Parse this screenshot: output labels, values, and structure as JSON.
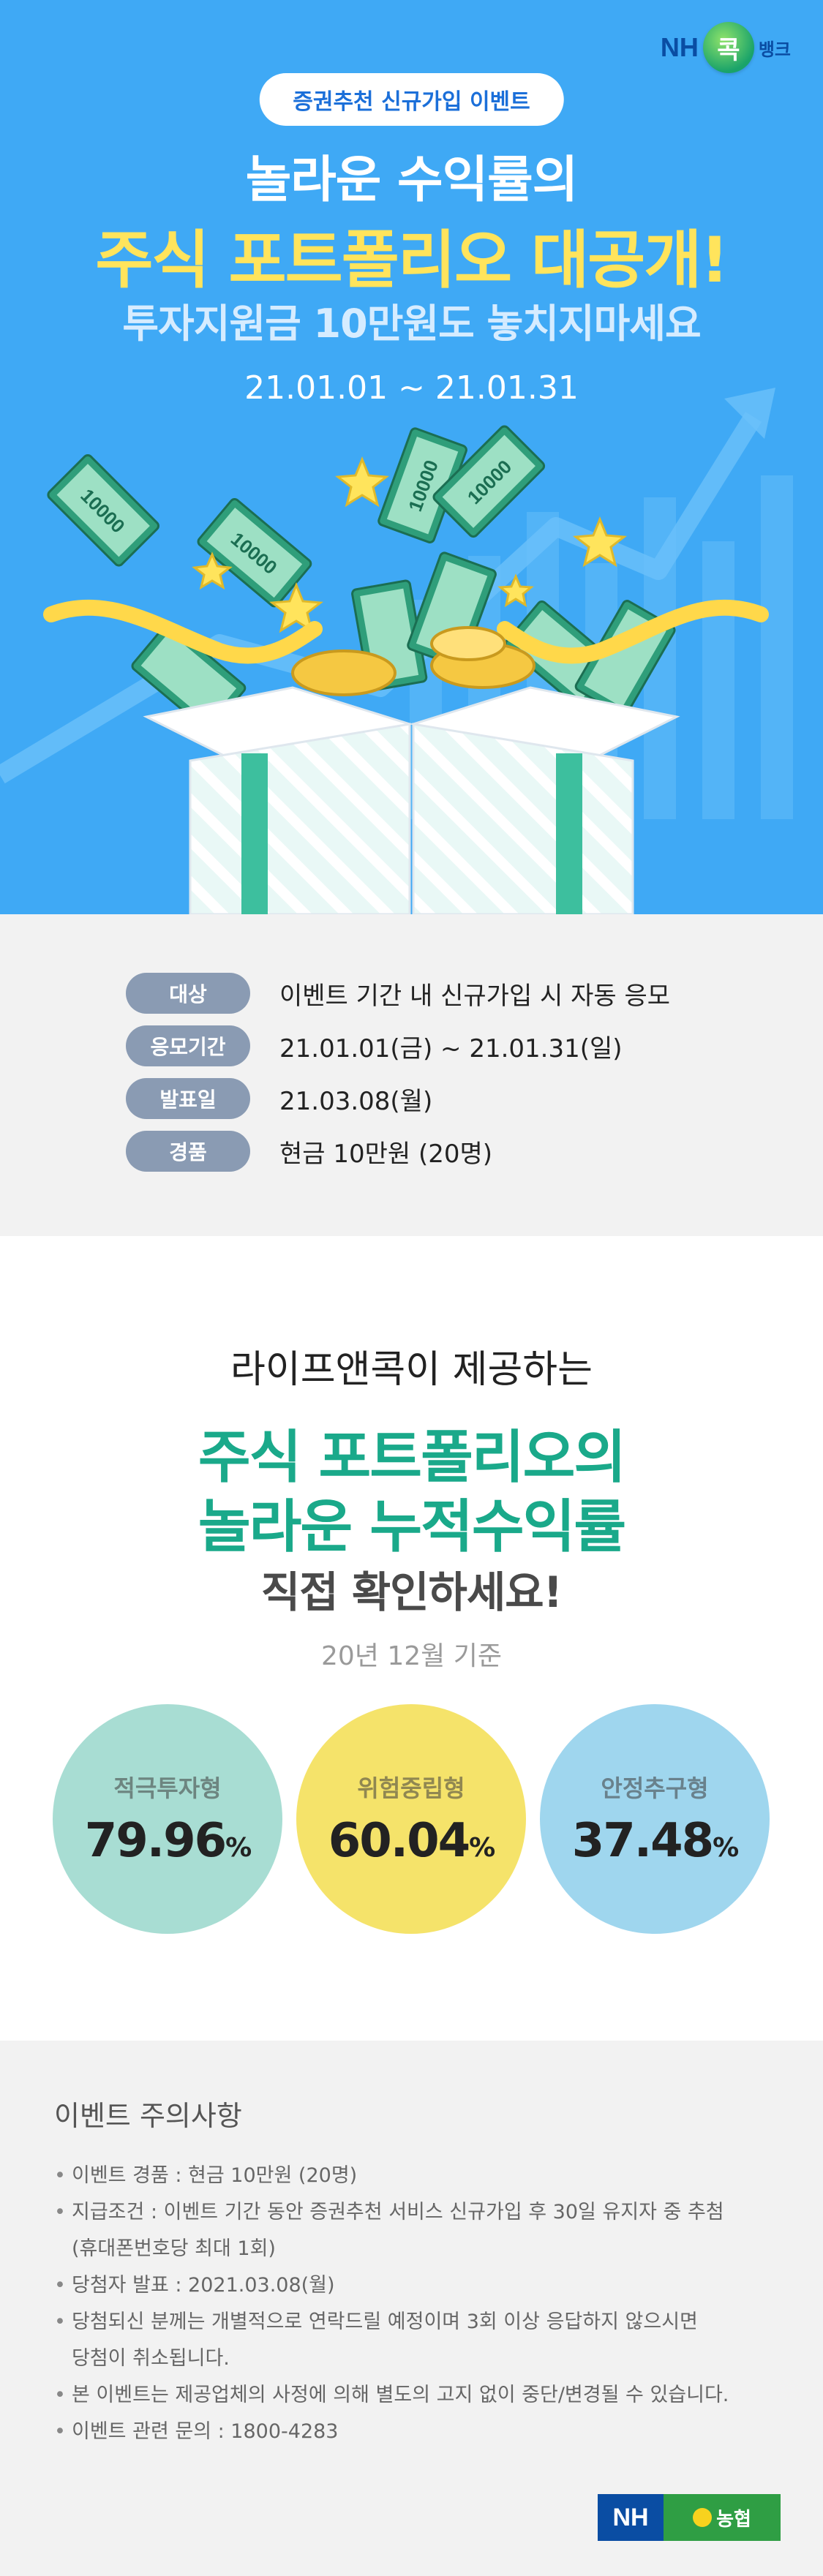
{
  "hero": {
    "logo": {
      "nh": "NH",
      "kok": "콕",
      "bank": "뱅크"
    },
    "pill": "증권추천 신규가입 이벤트",
    "line1": "놀라운 수익률의",
    "line2": "주식 포트폴리오 대공개!",
    "line3": "투자지원금 10만원도 놓치지마세요",
    "date": "21.01.01 ~ 21.01.31",
    "bill_text": "10000"
  },
  "info": {
    "rows": [
      {
        "tag": "대상",
        "value": "이벤트 기간 내 신규가입 시 자동 응모"
      },
      {
        "tag": "응모기간",
        "value": "21.01.01(금) ~ 21.01.31(일)"
      },
      {
        "tag": "발표일",
        "value": "21.03.08(월)"
      },
      {
        "tag": "경품",
        "value": "현금 10만원 (20명)"
      }
    ]
  },
  "portfolio": {
    "sub": "라이프앤콕이 제공하는",
    "h1": "주식 포트폴리오의",
    "h2": "놀라운 누적수익률",
    "h3": "직접 확인하세요!",
    "base": "20년 12월 기준",
    "circles": [
      {
        "label": "적극투자형",
        "value": "79.96",
        "unit": "%",
        "color": "#a8ddd3"
      },
      {
        "label": "위험중립형",
        "value": "60.04",
        "unit": "%",
        "color": "#f5e36a"
      },
      {
        "label": "안정추구형",
        "value": "37.48",
        "unit": "%",
        "color": "#9fd6ee"
      }
    ]
  },
  "notes": {
    "title": "이벤트 주의사항",
    "items": [
      "이벤트 경품 : 현금 10만원 (20명)",
      "지급조건 : 이벤트 기간 동안 증권추천 서비스 신규가입 후 30일 유지자 중 추첨",
      "(휴대폰번호당 최대 1회)",
      "당첨자 발표 : 2021.03.08(월)",
      "당첨되신 분께는 개별적으로 연락드릴 예정이며 3회 이상 응답하지 않으시면",
      "당첨이 취소됩니다.",
      "본 이벤트는 제공업체의 사정에 의해 별도의 고지 없이 중단/변경될 수 있습니다.",
      "이벤트 관련 문의 : 1800-4283"
    ],
    "logo": {
      "nh": "NH",
      "nong": "농협"
    }
  }
}
